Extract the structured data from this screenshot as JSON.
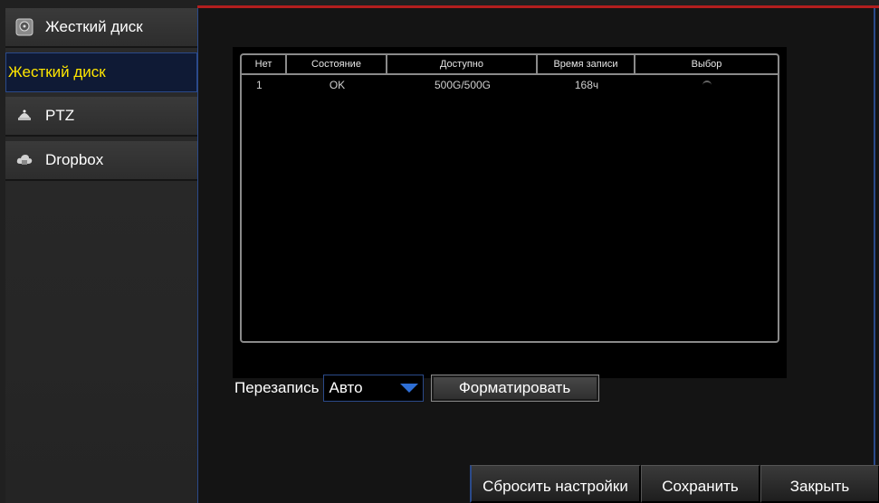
{
  "sidebar": {
    "header": {
      "label": "Жесткий диск",
      "icon": "hard-disk-icon"
    },
    "items": [
      {
        "label": "Жесткий диск",
        "selected": true
      },
      {
        "label": "PTZ",
        "icon": "ptz-camera-icon"
      },
      {
        "label": "Dropbox",
        "icon": "cloud-icon"
      }
    ]
  },
  "table": {
    "columns": [
      "Нет",
      "Состояние",
      "Доступно",
      "Время записи",
      "Выбор"
    ],
    "rows": [
      {
        "num": "1",
        "state": "OK",
        "available": "500G/500G",
        "record_time": "168ч",
        "selected": false
      }
    ]
  },
  "overwrite": {
    "label": "Перезапись",
    "value": "Авто"
  },
  "format_button": "Форматировать",
  "footer": {
    "reset": "Сбросить настройки",
    "save": "Сохранить",
    "close": "Закрыть"
  },
  "colors": {
    "accent_blue": "#2b4a8a",
    "selected_text": "#ffe600",
    "top_bar_red": "#b21e1e"
  }
}
